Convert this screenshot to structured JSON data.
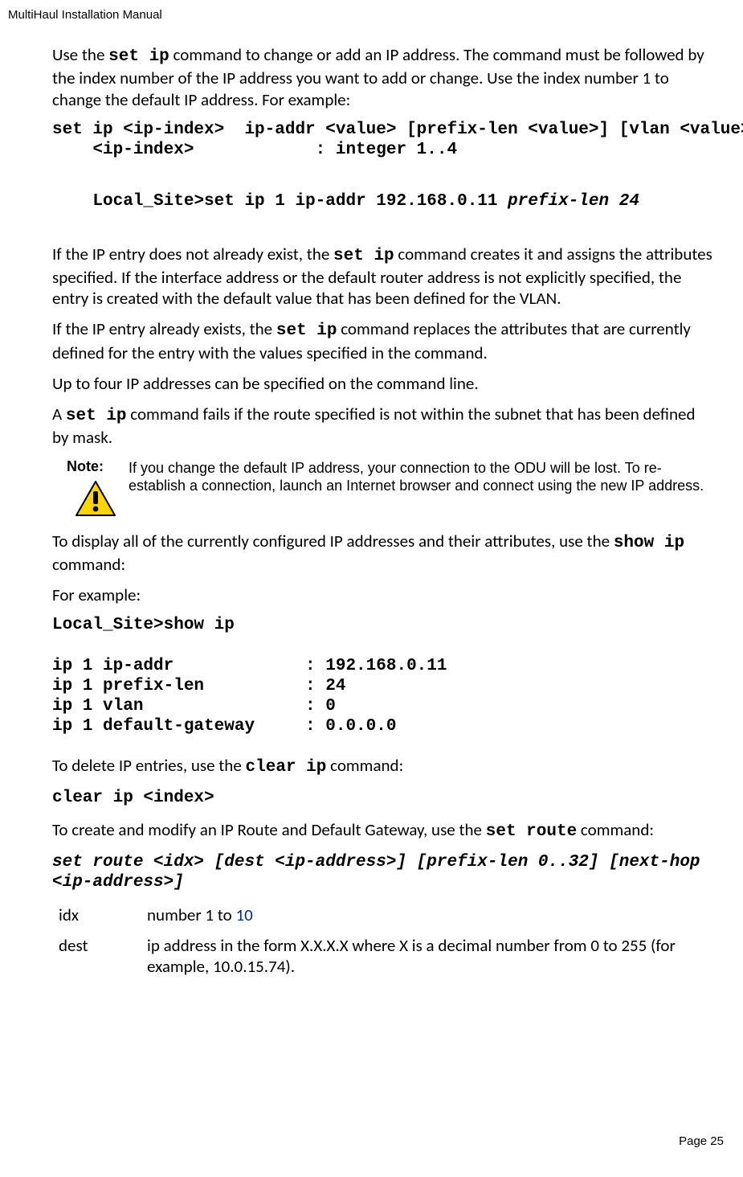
{
  "header": {
    "running": "MultiHaul Installation Manual"
  },
  "p1a": "Use the ",
  "p1code": "set ip",
  "p1b": " command to change or add an IP address. The command must be followed by the index number of the IP address you want to add or change. Use the index number 1 to change the default IP address. For example:",
  "code1": "set ip <ip-index>  ip-addr <value> [prefix-len <value>] [vlan <value>]\n    <ip-index>            : integer 1..4",
  "code2a": "Local_Site>set ip 1 ip-addr 192.168.0.11 ",
  "code2b": "prefix-len 24",
  "p2a": "If the IP entry does not already exist, the ",
  "p2code": "set ip",
  "p2b": " command creates it and assigns the attributes specified. If the interface address or the default router address is not explicitly specified, the entry is created with the default value that has been defined for the VLAN.",
  "p3a": "If the IP entry already exists, the ",
  "p3code": "set ip",
  "p3b": " command replaces the attributes that are currently defined for the entry with the values specified in the command.",
  "p4": "Up to four IP addresses can be specified on the command line.",
  "p5a": "A ",
  "p5code": "set ip",
  "p5b": " command fails if the route specified is not within the subnet that has been defined by mask.",
  "note": {
    "label": "Note:",
    "body": "If you change the default IP address, your connection to the ODU will be lost. To re-establish a connection, launch an Internet browser and connect using the new IP address."
  },
  "p6a": "To display all of the currently configured IP addresses and their attributes, use the ",
  "p6code": "show ip",
  "p6b": " command:",
  "p7": "For example:",
  "code3": "Local_Site>show ip\n\nip 1 ip-addr             : 192.168.0.11\nip 1 prefix-len          : 24\nip 1 vlan                : 0\nip 1 default-gateway     : 0.0.0.0",
  "p8a": "To delete IP entries, use the ",
  "p8code": "clear ip",
  "p8b": " command:",
  "code4": "clear ip <index>",
  "p9a": "To create and modify an IP Route and Default Gateway, use the ",
  "p9code": "set route",
  "p9b": " command:",
  "code5": "set route <idx> [dest <ip-address>] [prefix-len 0..32] [next-hop <ip-address>]",
  "defs": {
    "idx_term": "idx",
    "idx_a": "number 1 to ",
    "idx_b": "10",
    "dest_term": "dest",
    "dest": "ip address in the form X.X.X.X where X is a decimal number from 0 to 255 (for example, 10.0.15.74)."
  },
  "footer": {
    "page": "Page 25"
  }
}
